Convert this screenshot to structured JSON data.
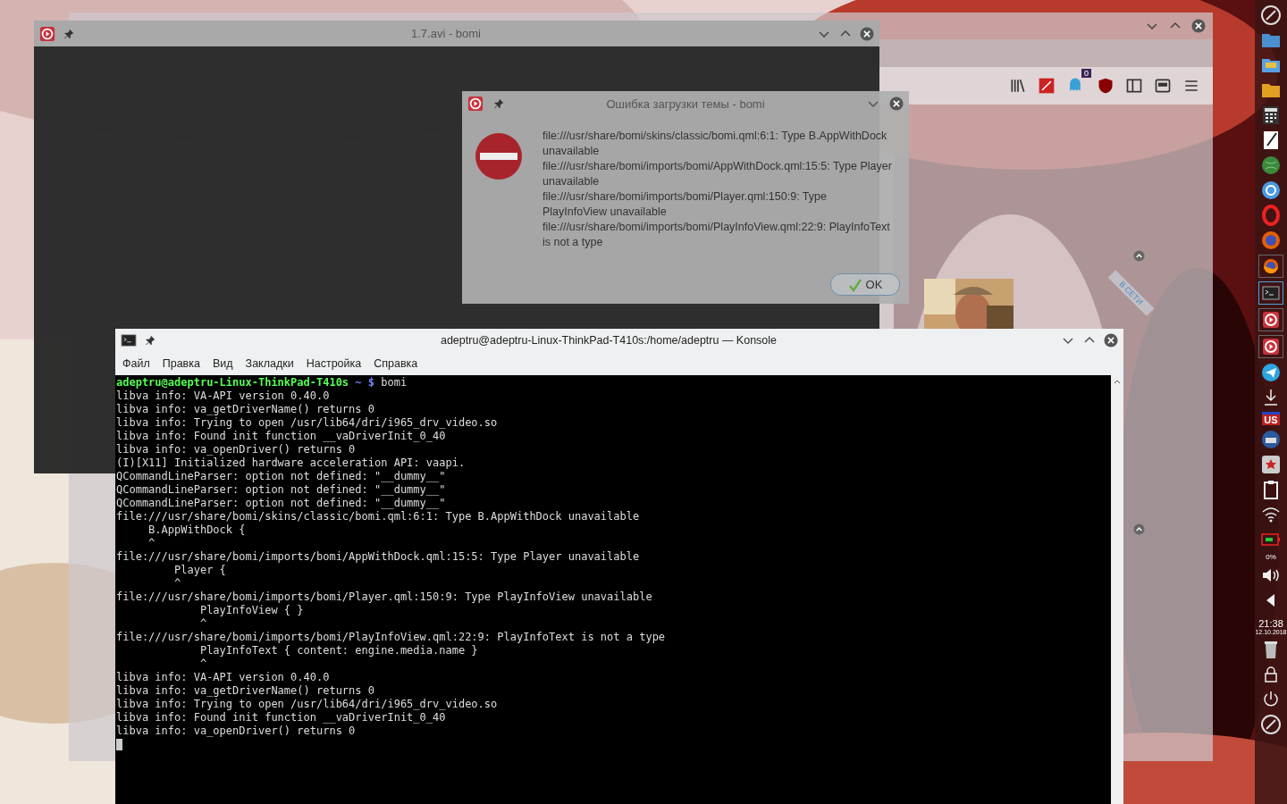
{
  "firefox": {
    "badge": "0",
    "status": "В СЕТИ"
  },
  "bomi": {
    "title": "1.7.avi - bomi"
  },
  "dialog": {
    "title": "Ошибка загрузки темы - bomi",
    "messages": [
      "file:///usr/share/bomi/skins/classic/bomi.qml:6:1: Type B.AppWithDock unavailable",
      "file:///usr/share/bomi/imports/bomi/AppWithDock.qml:15:5: Type Player unavailable",
      "file:///usr/share/bomi/imports/bomi/Player.qml:150:9: Type PlayInfoView unavailable",
      "file:///usr/share/bomi/imports/bomi/PlayInfoView.qml:22:9: PlayInfoText is not a type"
    ],
    "ok": "OK"
  },
  "konsole": {
    "title": "adeptru@adeptru-Linux-ThinkPad-T410s:/home/adeptru — Konsole",
    "menu": [
      "Файл",
      "Правка",
      "Вид",
      "Закладки",
      "Настройка",
      "Справка"
    ],
    "lines": [
      {
        "kind": "prompt",
        "user": "adeptru@adeptru-Linux-ThinkPad-T410s",
        "path": "~ $",
        "command": "bomi"
      },
      {
        "kind": "output",
        "text": "libva info: VA-API version 0.40.0"
      },
      {
        "kind": "output",
        "text": "libva info: va_getDriverName() returns 0"
      },
      {
        "kind": "output",
        "text": "libva info: Trying to open /usr/lib64/dri/i965_drv_video.so"
      },
      {
        "kind": "output",
        "text": "libva info: Found init function __vaDriverInit_0_40"
      },
      {
        "kind": "output",
        "text": "libva info: va_openDriver() returns 0"
      },
      {
        "kind": "output",
        "text": "(I)[X11] Initialized hardware acceleration API: vaapi."
      },
      {
        "kind": "output",
        "text": "QCommandLineParser: option not defined: \"__dummy__\""
      },
      {
        "kind": "output",
        "text": "QCommandLineParser: option not defined: \"__dummy__\""
      },
      {
        "kind": "output",
        "text": "QCommandLineParser: option not defined: \"__dummy__\""
      },
      {
        "kind": "output",
        "text": "file:///usr/share/bomi/skins/classic/bomi.qml:6:1: Type B.AppWithDock unavailable"
      },
      {
        "kind": "output",
        "text": "     B.AppWithDock {"
      },
      {
        "kind": "output",
        "text": "     ^"
      },
      {
        "kind": "output",
        "text": "file:///usr/share/bomi/imports/bomi/AppWithDock.qml:15:5: Type Player unavailable"
      },
      {
        "kind": "output",
        "text": "         Player {"
      },
      {
        "kind": "output",
        "text": "         ^"
      },
      {
        "kind": "output",
        "text": "file:///usr/share/bomi/imports/bomi/Player.qml:150:9: Type PlayInfoView unavailable"
      },
      {
        "kind": "output",
        "text": "             PlayInfoView { }"
      },
      {
        "kind": "output",
        "text": "             ^"
      },
      {
        "kind": "output",
        "text": "file:///usr/share/bomi/imports/bomi/PlayInfoView.qml:22:9: PlayInfoText is not a type"
      },
      {
        "kind": "output",
        "text": "             PlayInfoText { content: engine.media.name }"
      },
      {
        "kind": "output",
        "text": "             ^"
      },
      {
        "kind": "output",
        "text": "libva info: VA-API version 0.40.0"
      },
      {
        "kind": "output",
        "text": "libva info: va_getDriverName() returns 0"
      },
      {
        "kind": "output",
        "text": "libva info: Trying to open /usr/lib64/dri/i965_drv_video.so"
      },
      {
        "kind": "output",
        "text": "libva info: Found init function __vaDriverInit_0_40"
      },
      {
        "kind": "output",
        "text": "libva info: va_openDriver() returns 0"
      },
      {
        "kind": "cursor"
      }
    ]
  },
  "panel": {
    "tasks": [
      {
        "kind": "firefox",
        "selected": false
      },
      {
        "kind": "terminal",
        "selected": true
      },
      {
        "kind": "player",
        "selected": false
      },
      {
        "kind": "player",
        "selected": false
      }
    ],
    "layout": "US",
    "battery": "0%",
    "time": "21:38",
    "date": "12.10.2018"
  }
}
